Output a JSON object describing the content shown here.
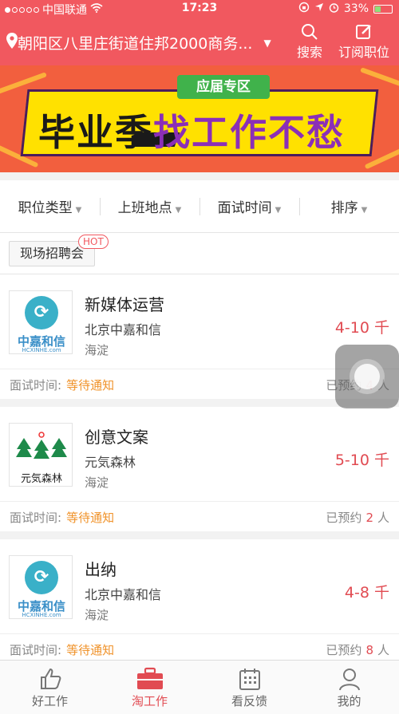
{
  "status": {
    "carrier": "中国联通",
    "time": "17:23",
    "battery": "33%",
    "battery_level": 0.33
  },
  "header": {
    "location": "朝阳区八里庄街道住邦2000商务...",
    "search_label": "搜索",
    "subscribe_label": "订阅职位"
  },
  "banner": {
    "tag": "应届专区",
    "slogan_part1": "毕业季",
    "slogan_part2": "找工作不愁"
  },
  "filters": [
    {
      "label": "职位类型"
    },
    {
      "label": "上班地点"
    },
    {
      "label": "面试时间"
    },
    {
      "label": "排序"
    }
  ],
  "chip": {
    "label": "现场招聘会",
    "badge": "HOT"
  },
  "jobs": [
    {
      "title": "新媒体运营",
      "company": "北京中嘉和信",
      "district": "海淀",
      "salary": "4-10 千",
      "interview_label": "面试时间:",
      "interview_value": "等待通知",
      "booked_prefix": "已预约",
      "booked_count": "4",
      "booked_suffix": "人",
      "logo_text": "中嘉和信",
      "logo_small": "HCXINHE.com"
    },
    {
      "title": "创意文案",
      "company": "元気森林",
      "district": "海淀",
      "salary": "5-10 千",
      "interview_label": "面试时间:",
      "interview_value": "等待通知",
      "booked_prefix": "已预约",
      "booked_count": "2",
      "booked_suffix": "人",
      "logo_text": "元気森林"
    },
    {
      "title": "出纳",
      "company": "北京中嘉和信",
      "district": "海淀",
      "salary": "4-8 千",
      "interview_label": "面试时间:",
      "interview_value": "等待通知",
      "booked_prefix": "已预约",
      "booked_count": "8",
      "booked_suffix": "人",
      "logo_text": "中嘉和信",
      "logo_small": "HCXINHE.com"
    }
  ],
  "tabs": [
    {
      "label": "好工作",
      "icon": "thumbs-up-icon"
    },
    {
      "label": "淘工作",
      "icon": "briefcase-icon"
    },
    {
      "label": "看反馈",
      "icon": "calendar-icon"
    },
    {
      "label": "我的",
      "icon": "person-icon"
    }
  ],
  "colors": {
    "brand": "#f1585f",
    "salary": "#e14b52",
    "pending": "#f0932b"
  }
}
